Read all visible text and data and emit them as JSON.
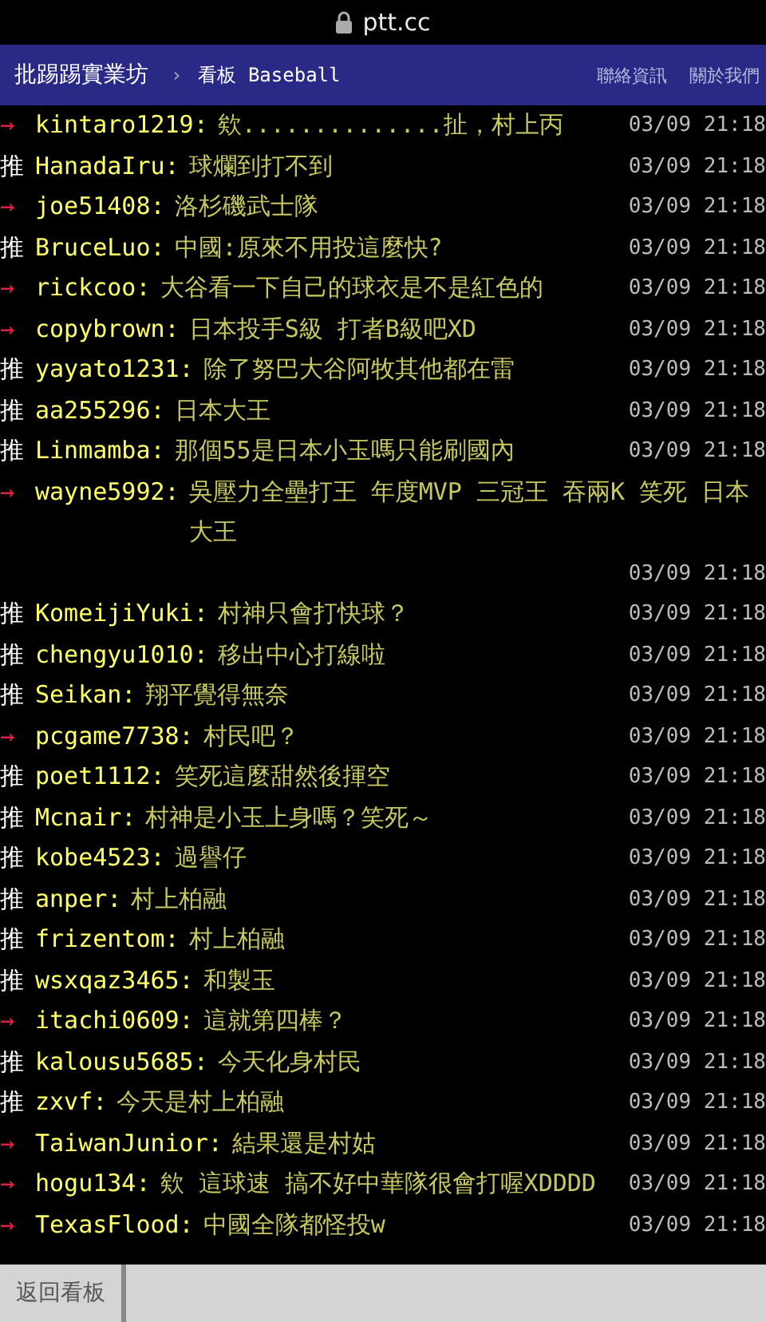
{
  "browser": {
    "url": "ptt.cc"
  },
  "header": {
    "site": "批踢踢實業坊",
    "separator": "›",
    "board_label": "看板",
    "board": "Baseball",
    "links": [
      "聯絡資訊",
      "關於我們"
    ]
  },
  "pushes": [
    {
      "kind": "arrow",
      "tag": "→",
      "user": "kintaro1219:",
      "content": "欸..............扯，村上丙",
      "time": "03/09 21:18"
    },
    {
      "kind": "push",
      "tag": "推",
      "user": "HanadaIru:",
      "content": "球爛到打不到",
      "time": "03/09 21:18"
    },
    {
      "kind": "arrow",
      "tag": "→",
      "user": "joe51408:",
      "content": "洛杉磯武士隊",
      "time": "03/09 21:18"
    },
    {
      "kind": "push",
      "tag": "推",
      "user": "BruceLuo:",
      "content": "中國:原來不用投這麼快?",
      "time": "03/09 21:18"
    },
    {
      "kind": "arrow",
      "tag": "→",
      "user": "rickcoo:",
      "content": "大谷看一下自己的球衣是不是紅色的",
      "time": "03/09 21:18"
    },
    {
      "kind": "arrow",
      "tag": "→",
      "user": "copybrown:",
      "content": "日本投手S級 打者B級吧XD",
      "time": "03/09 21:18"
    },
    {
      "kind": "push",
      "tag": "推",
      "user": "yayato1231:",
      "content": "除了努巴大谷阿牧其他都在雷",
      "time": "03/09 21:18"
    },
    {
      "kind": "push",
      "tag": "推",
      "user": "aa255296:",
      "content": "日本大王",
      "time": "03/09 21:18"
    },
    {
      "kind": "push",
      "tag": "推",
      "user": "Linmamba:",
      "content": "那個55是日本小玉嗎只能刷國內",
      "time": "03/09 21:18"
    },
    {
      "kind": "arrow",
      "tag": "→",
      "user": "wayne5992:",
      "content": "吳壓力全壘打王 年度MVP 三冠王 吞兩K 笑死 日本大王",
      "time": "03/09 21:18"
    },
    {
      "kind": "push",
      "tag": "推",
      "user": "KomeijiYuki:",
      "content": "村神只會打快球？",
      "time": "03/09 21:18"
    },
    {
      "kind": "push",
      "tag": "推",
      "user": "chengyu1010:",
      "content": "移出中心打線啦",
      "time": "03/09 21:18"
    },
    {
      "kind": "push",
      "tag": "推",
      "user": "Seikan:",
      "content": "翔平覺得無奈",
      "time": "03/09 21:18"
    },
    {
      "kind": "arrow",
      "tag": "→",
      "user": "pcgame7738:",
      "content": "村民吧？",
      "time": "03/09 21:18"
    },
    {
      "kind": "push",
      "tag": "推",
      "user": "poet1112:",
      "content": "笑死這麼甜然後揮空",
      "time": "03/09 21:18"
    },
    {
      "kind": "push",
      "tag": "推",
      "user": "Mcnair:",
      "content": "村神是小玉上身嗎？笑死～",
      "time": "03/09 21:18"
    },
    {
      "kind": "push",
      "tag": "推",
      "user": "kobe4523:",
      "content": "過譽仔",
      "time": "03/09 21:18"
    },
    {
      "kind": "push",
      "tag": "推",
      "user": "anper:",
      "content": "村上柏融",
      "time": "03/09 21:18"
    },
    {
      "kind": "push",
      "tag": "推",
      "user": "frizentom:",
      "content": "村上柏融",
      "time": "03/09 21:18"
    },
    {
      "kind": "push",
      "tag": "推",
      "user": "wsxqaz3465:",
      "content": "和製玉",
      "time": "03/09 21:18"
    },
    {
      "kind": "arrow",
      "tag": "→",
      "user": "itachi0609:",
      "content": "這就第四棒？",
      "time": "03/09 21:18"
    },
    {
      "kind": "push",
      "tag": "推",
      "user": "kalousu5685:",
      "content": "今天化身村民",
      "time": "03/09 21:18"
    },
    {
      "kind": "push",
      "tag": "推",
      "user": "zxvf:",
      "content": "今天是村上柏融",
      "time": "03/09 21:18"
    },
    {
      "kind": "arrow",
      "tag": "→",
      "user": "TaiwanJunior:",
      "content": "結果還是村姑",
      "time": "03/09 21:18"
    },
    {
      "kind": "arrow",
      "tag": "→",
      "user": "hogu134:",
      "content": "欸 這球速 搞不好中華隊很會打喔XDDDD",
      "time": "03/09 21:18"
    },
    {
      "kind": "arrow",
      "tag": "→",
      "user": "TexasFlood:",
      "content": "中國全隊都怪投w",
      "time": "03/09 21:18"
    }
  ],
  "footer": {
    "back_button": "返回看板"
  }
}
